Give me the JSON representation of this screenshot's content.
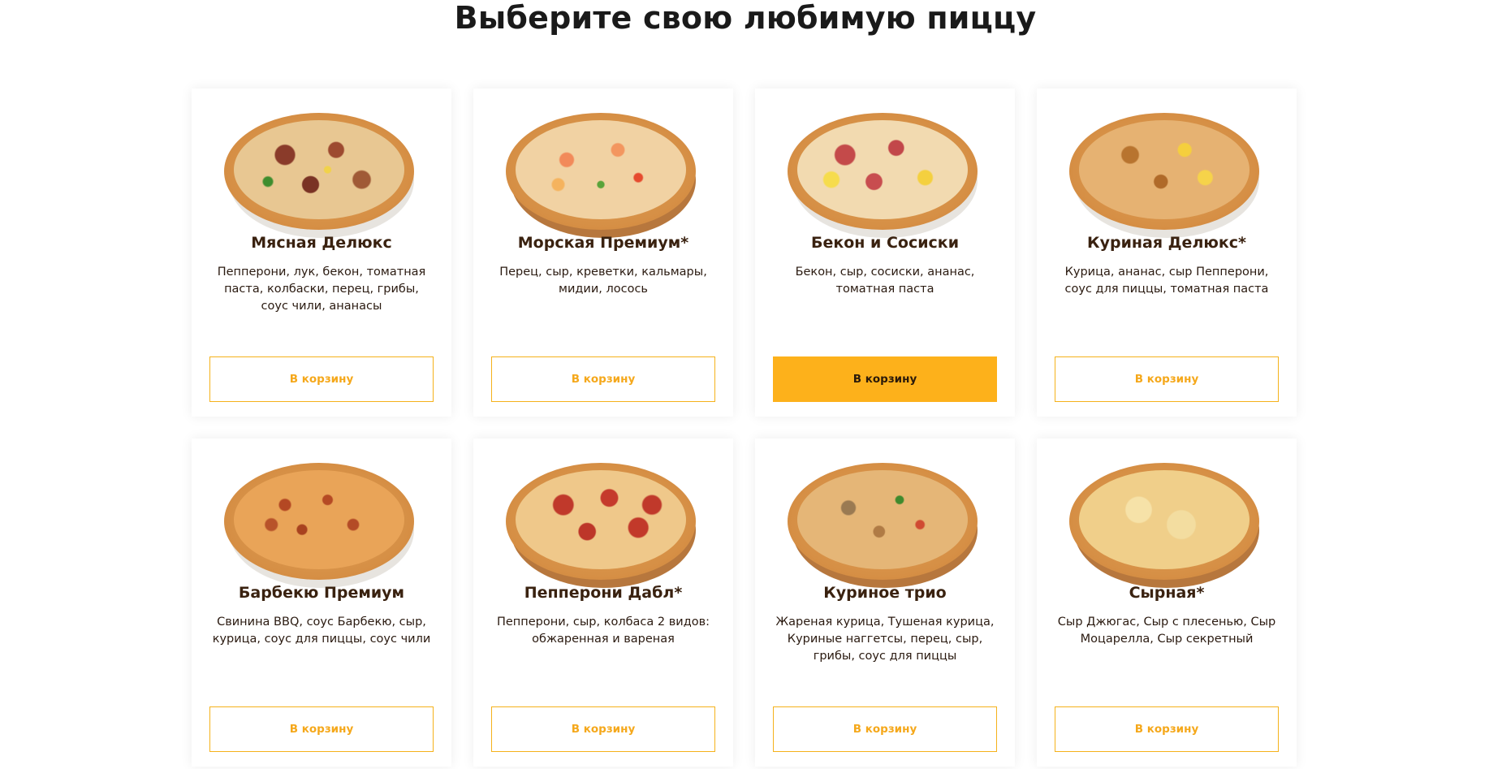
{
  "page": {
    "title": "Выберите свою любимую пиццу"
  },
  "colors": {
    "accent": "#fdb11b",
    "accent_text": "#f5a81b",
    "title_text": "#3a2210"
  },
  "pizzas": [
    {
      "name": "Мясная Делюкс",
      "description": "Пепперони, лук, бекон, томатная паста, колбаски, перец, грибы, соус чили, ананасы",
      "button_label": "В корзину",
      "image": "pizza-meat-deluxe-image"
    },
    {
      "name": "Морская Премиум*",
      "description": "Перец, сыр, креветки, кальмары, мидии, лосось",
      "button_label": "В корзину",
      "image": "pizza-seafood-premium-image"
    },
    {
      "name": "Бекон и Сосиски",
      "description": "Бекон, сыр, сосиски, ананас, томатная паста",
      "button_label": "В корзину",
      "image": "pizza-bacon-sausage-image"
    },
    {
      "name": "Куриная Делюкс*",
      "description": "Курица, ананас, сыр Пепперони, соус для пиццы, томатная паста",
      "button_label": "В корзину",
      "image": "pizza-chicken-deluxe-image"
    },
    {
      "name": "Барбекю Премиум",
      "description": "Свинина BBQ, соус Барбекю, сыр, курица, соус для пиццы, соус чили",
      "button_label": "В корзину",
      "image": "pizza-bbq-premium-image"
    },
    {
      "name": "Пепперони Дабл*",
      "description": "Пепперони, сыр, колбаса 2 видов: обжаренная и вареная",
      "button_label": "В корзину",
      "image": "pizza-pepperoni-double-image"
    },
    {
      "name": "Куриное трио",
      "description": "Жареная курица, Тушеная курица, Куриные наггетсы, перец, сыр, грибы, соус для пиццы",
      "button_label": "В корзину",
      "image": "pizza-chicken-trio-image"
    },
    {
      "name": "Сырная*",
      "description": "Сыр Джюгас, Сыр с плесенью, Сыр Моцарелла, Сыр секретный",
      "button_label": "В корзину",
      "image": "pizza-cheese-image"
    }
  ]
}
